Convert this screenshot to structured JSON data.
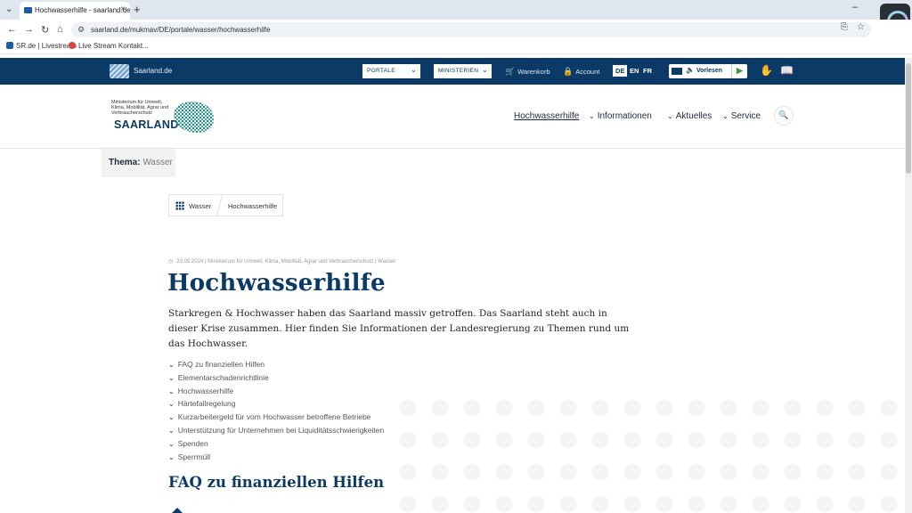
{
  "browser": {
    "tab_title": "Hochwasserhilfe - saarland.de",
    "url": "saarland.de/mukmav/DE/portale/wasser/hochwasserhilfe",
    "bookmarks": [
      {
        "label": "SR.de | Livestream",
        "color": "#1e5aa8"
      },
      {
        "label": "Live Stream Kontakt...",
        "color": "#d9453a"
      }
    ]
  },
  "topbar": {
    "logo_text": "Saarland.de",
    "portale_label": "PORTALE",
    "ministerien_label": "MINISTERIEN",
    "warenkorb_label": "Warenkorb",
    "account_label": "Account",
    "languages": [
      "DE",
      "EN",
      "FR"
    ],
    "vorlesen_label": "Vorlesen"
  },
  "header": {
    "ministry_name": "Ministerium für Umwelt, Klima, Mobilität, Agrar und Verbraucherschutz",
    "brand": "SAARLAND",
    "nav": [
      {
        "label": "Hochwasserhilfe"
      },
      {
        "label": "Informationen"
      },
      {
        "label": "Aktuelles"
      },
      {
        "label": "Service"
      }
    ]
  },
  "thema": {
    "label": "Thema:",
    "value": "Wasser"
  },
  "breadcrumb": {
    "items": [
      "Wasser",
      "Hochwasserhilfe"
    ]
  },
  "article": {
    "meta": "20.05.2024 | Ministerium für Umwelt, Klima, Mobilität, Agrar und Verbraucherschutz | Wasser",
    "title": "Hochwasserhilfe",
    "intro": "Starkregen & Hochwasser haben das Saarland massiv getroffen. Das Saarland steht auch in dieser Krise zusammen. Hier finden Sie Informationen der Landesregierung zu Themen rund um das Hochwasser.",
    "toc": [
      "FAQ zu finanziellen Hilfen",
      "Elementarschadenrichtlinie",
      "Hochwasserhilfe",
      "Härtefallregelung",
      "Kurzarbeitergeld für vom Hochwasser betroffene Betriebe",
      "Unterstützung für Unternehmen bei Liquiditätsschwierigkeiten",
      "Spenden",
      "Sperrmüll"
    ],
    "section_title": "FAQ zu finanziellen Hilfen"
  },
  "colors": {
    "brand_blue": "#0b3a66",
    "accent_green": "#3a9a3a"
  }
}
